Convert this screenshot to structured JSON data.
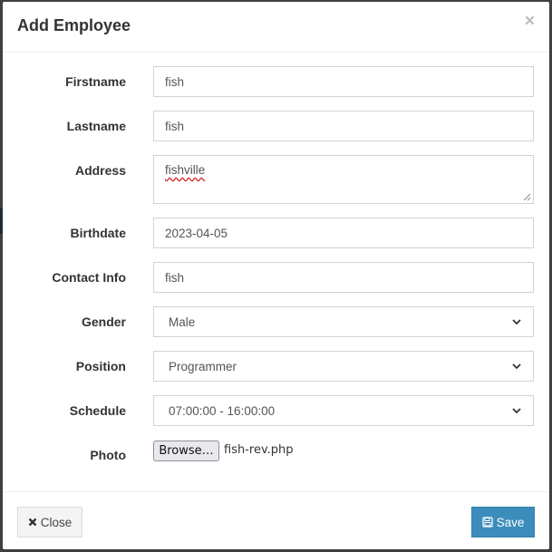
{
  "modal": {
    "title": "Add Employee",
    "close_symbol": "×"
  },
  "form": {
    "firstname": {
      "label": "Firstname",
      "value": "fish"
    },
    "lastname": {
      "label": "Lastname",
      "value": "fish"
    },
    "address": {
      "label": "Address",
      "value": "fishville"
    },
    "birthdate": {
      "label": "Birthdate",
      "value": "2023-04-05"
    },
    "contact": {
      "label": "Contact Info",
      "value": "fish"
    },
    "gender": {
      "label": "Gender",
      "selected": "Male"
    },
    "position": {
      "label": "Position",
      "selected": "Programmer"
    },
    "schedule": {
      "label": "Schedule",
      "selected": "07:00:00 - 16:00:00"
    },
    "photo": {
      "label": "Photo",
      "browse_label": "Browse…",
      "file_name": "fish-rev.php"
    }
  },
  "footer": {
    "close_label": "Close",
    "save_label": "Save"
  },
  "icons": {
    "close": "times-icon",
    "save": "floppy-disk-icon",
    "select": "chevron-down-icon"
  },
  "colors": {
    "primary": "#3c8dbc",
    "default_button": "#f4f4f4",
    "backdrop": "#3d3f41"
  }
}
